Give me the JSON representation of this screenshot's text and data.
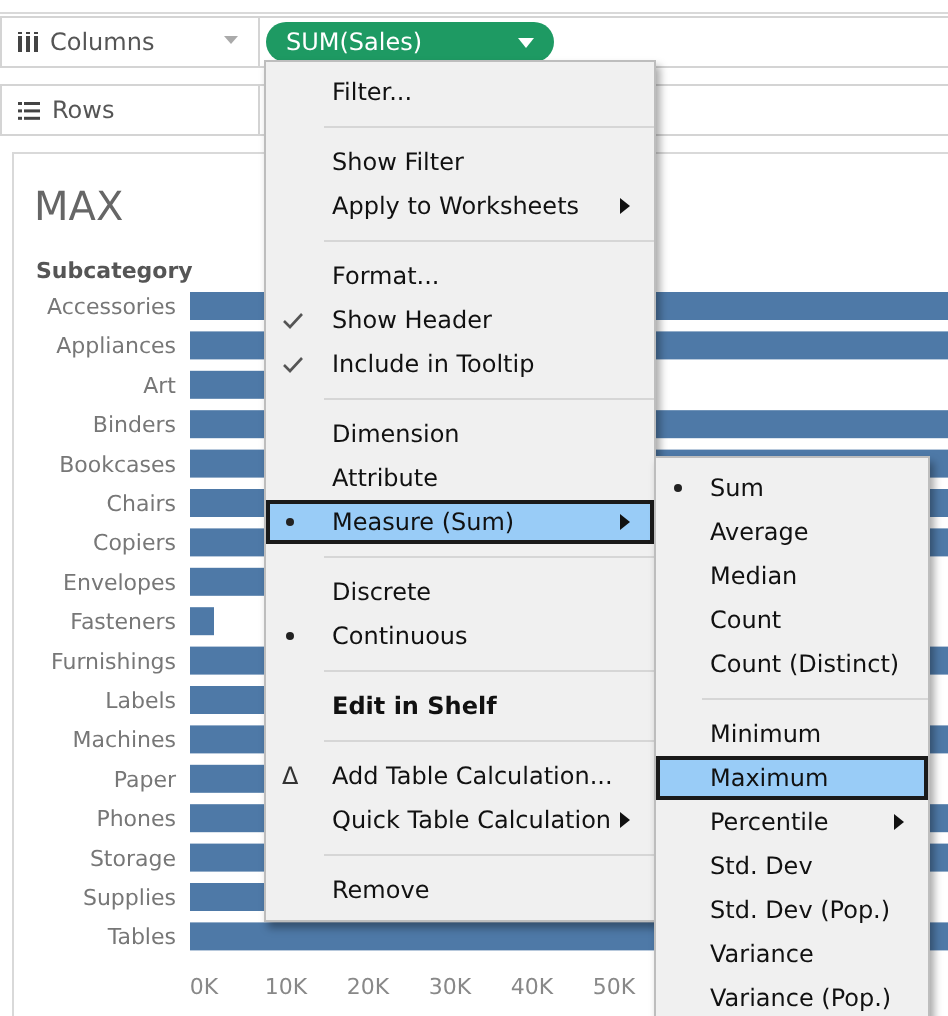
{
  "shelves": [
    {
      "kind": "columns",
      "label": "Columns",
      "pill": "SUM(Sales)"
    },
    {
      "kind": "rows",
      "label": "Rows"
    }
  ],
  "view": {
    "title": "MAX",
    "row_header": "Subcategory",
    "categories": [
      "Accessories",
      "Appliances",
      "Art",
      "Binders",
      "Bookcases",
      "Chairs",
      "Copiers",
      "Envelopes",
      "Fasteners",
      "Furnishings",
      "Labels",
      "Machines",
      "Paper",
      "Phones",
      "Storage",
      "Supplies",
      "Tables"
    ],
    "axis_labels": [
      "0K",
      "10K",
      "20K",
      "30K",
      "40K",
      "50K"
    ]
  },
  "context_menu": {
    "items": [
      {
        "kind": "command",
        "label": "Filter...",
        "submenu": false,
        "highlighted": false
      },
      {
        "kind": "separator"
      },
      {
        "kind": "command",
        "label": "Show Filter",
        "submenu": false,
        "highlighted": false
      },
      {
        "kind": "command",
        "label": "Apply to Worksheets",
        "submenu": true,
        "highlighted": false
      },
      {
        "kind": "separator"
      },
      {
        "kind": "command",
        "label": "Format...",
        "submenu": false,
        "highlighted": false
      },
      {
        "kind": "check",
        "label": "Show Header",
        "checked": true,
        "submenu": false,
        "highlighted": false
      },
      {
        "kind": "check",
        "label": "Include in Tooltip",
        "checked": true,
        "submenu": false,
        "highlighted": false
      },
      {
        "kind": "separator"
      },
      {
        "kind": "radio",
        "label": "Dimension",
        "selected": false,
        "submenu": false,
        "highlighted": false
      },
      {
        "kind": "radio",
        "label": "Attribute",
        "selected": false,
        "submenu": false,
        "highlighted": false
      },
      {
        "kind": "radio",
        "label": "Measure (Sum)",
        "selected": true,
        "submenu": true,
        "highlighted": true
      },
      {
        "kind": "separator"
      },
      {
        "kind": "radio",
        "label": "Discrete",
        "selected": false,
        "submenu": false,
        "highlighted": false
      },
      {
        "kind": "radio",
        "label": "Continuous",
        "selected": true,
        "submenu": false,
        "highlighted": false
      },
      {
        "kind": "separator"
      },
      {
        "kind": "default",
        "label": "Edit in Shelf",
        "submenu": false,
        "highlighted": false
      },
      {
        "kind": "separator"
      },
      {
        "kind": "glyph",
        "glyph": "Δ",
        "label": "Add Table Calculation...",
        "submenu": false,
        "highlighted": false
      },
      {
        "kind": "command",
        "label": "Quick Table Calculation",
        "submenu": true,
        "highlighted": false
      },
      {
        "kind": "separator"
      },
      {
        "kind": "command",
        "label": "Remove",
        "submenu": false,
        "highlighted": false
      }
    ]
  },
  "submenu": {
    "items": [
      {
        "kind": "radio",
        "label": "Sum",
        "selected": true,
        "submenu": false,
        "highlighted": false
      },
      {
        "kind": "radio",
        "label": "Average",
        "selected": false,
        "submenu": false,
        "highlighted": false
      },
      {
        "kind": "radio",
        "label": "Median",
        "selected": false,
        "submenu": false,
        "highlighted": false
      },
      {
        "kind": "radio",
        "label": "Count",
        "selected": false,
        "submenu": false,
        "highlighted": false
      },
      {
        "kind": "radio",
        "label": "Count (Distinct)",
        "selected": false,
        "submenu": false,
        "highlighted": false
      },
      {
        "kind": "separator"
      },
      {
        "kind": "radio",
        "label": "Minimum",
        "selected": false,
        "submenu": false,
        "highlighted": false
      },
      {
        "kind": "radio",
        "label": "Maximum",
        "selected": false,
        "submenu": false,
        "highlighted": true
      },
      {
        "kind": "radio",
        "label": "Percentile",
        "selected": false,
        "submenu": true,
        "highlighted": false
      },
      {
        "kind": "radio",
        "label": "Std. Dev",
        "selected": false,
        "submenu": false,
        "highlighted": false
      },
      {
        "kind": "radio",
        "label": "Std. Dev (Pop.)",
        "selected": false,
        "submenu": false,
        "highlighted": false
      },
      {
        "kind": "radio",
        "label": "Variance",
        "selected": false,
        "submenu": false,
        "highlighted": false
      },
      {
        "kind": "radio",
        "label": "Variance (Pop.)",
        "selected": false,
        "submenu": false,
        "highlighted": false
      }
    ]
  }
}
